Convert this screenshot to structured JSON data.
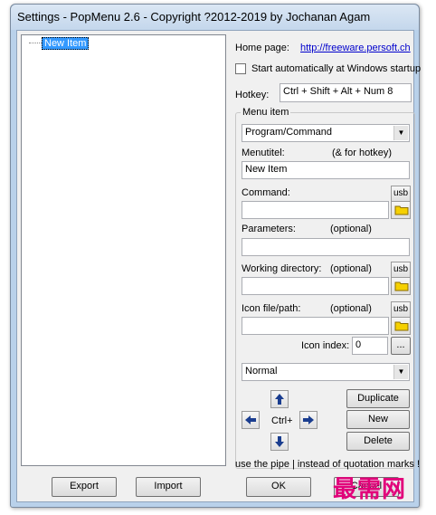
{
  "window": {
    "title": "Settings - PopMenu 2.6 - Copyright ?2012-2019 by Jochanan Agam"
  },
  "tree": {
    "items": [
      {
        "label": "New Item",
        "selected": true
      }
    ]
  },
  "settings": {
    "homepage_label": "Home page:",
    "homepage_link": "http://freeware.persoft.ch",
    "startup_label": "Start automatically at Windows startup",
    "startup_checked": false,
    "hotkey_label": "Hotkey:",
    "hotkey_value": "Ctrl + Shift + Alt + Num 8"
  },
  "menu_item": {
    "group_label": "Menu item",
    "type_value": "Program/Command",
    "menutitle_label": "Menutitel:",
    "menutitle_hint": "(& for hotkey)",
    "menutitle_value": "New Item",
    "command_label": "Command:",
    "command_value": "",
    "parameters_label": "Parameters:",
    "parameters_hint": "(optional)",
    "parameters_value": "",
    "workdir_label": "Working directory:",
    "workdir_hint": "(optional)",
    "workdir_value": "",
    "icon_label": "Icon file/path:",
    "icon_hint": "(optional)",
    "icon_value": "",
    "icon_index_label": "Icon index:",
    "icon_index_value": "0",
    "browse_label": "...",
    "usb_label": "usb",
    "window_mode_value": "Normal",
    "move_label": "Ctrl+",
    "duplicate_label": "Duplicate",
    "new_label": "New",
    "delete_label": "Delete",
    "pipe_hint": "use the pipe | instead of quotation marks !"
  },
  "footer": {
    "export_label": "Export",
    "import_label": "Import",
    "ok_label": "OK",
    "cancel_label": "Cancel"
  },
  "watermark": {
    "text": "最需网"
  },
  "colors": {
    "selection": "#3399ff",
    "link": "#0000cc",
    "arrow_blue": "#1a3d8f",
    "folder_yellow": "#f5d000",
    "watermark": "#e2007a"
  }
}
